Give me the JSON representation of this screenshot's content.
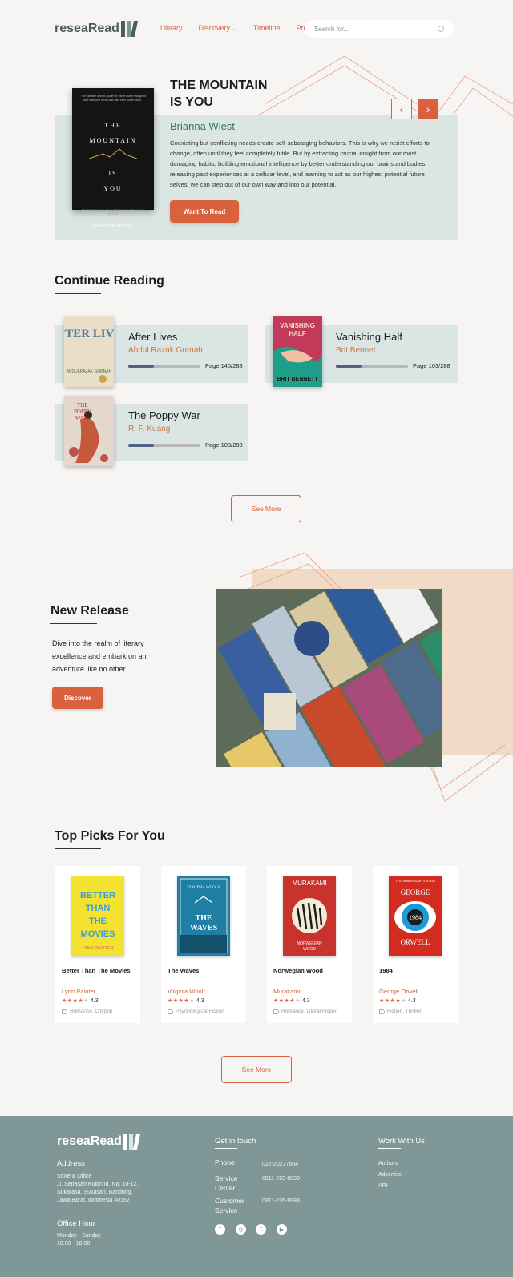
{
  "header": {
    "logo_text": "reseaRead",
    "nav": [
      "Library",
      "Discovery",
      "Timeline",
      "Profile"
    ],
    "search_placeholder": "Search for..."
  },
  "hero": {
    "title": "THE MOUNTAIN IS YOU",
    "author": "Brianna Wiest",
    "description": "Coexisting but conflicting needs create self-sabotaging behaviors. This is why we resist efforts to change, often until they feel completely futile. But by extracting crucial insight from our most damaging habits, building emotional intelligence by better understanding our brains and bodies, releasing past experiences at a cellular level, and learning to act as our highest potential future selves, we can step out of our own way and into our potential.",
    "button": "Want To Read",
    "cover": {
      "blurb": "\"The ultimate world's guide for those brave enough to face their true worth and take their power back.\"",
      "title_lines": [
        "THE",
        "MOUNTAIN",
        "IS",
        "YOU"
      ],
      "subtitle": "TRANSFORMING SELF-SABOTAGE INTO SELF-MASTERY",
      "author": "BRIANNA WIEST"
    }
  },
  "continue_reading": {
    "title": "Continue Reading",
    "books": [
      {
        "title": "After Lives",
        "author": "Abdul Razak Gurnah",
        "page": "Page 140/288",
        "progress": 0.35,
        "cover_text": "AFTER LIVES",
        "cover_author": "ABDULRAZAK GURNAH"
      },
      {
        "title": "Vanishing Half",
        "author": "Brit Bennet",
        "page": "Page 103/288",
        "progress": 0.36,
        "cover_text": "VANISHING HALF",
        "cover_author": "BRIT BENNETT"
      },
      {
        "title": "The Poppy War",
        "author": "R. F. Kuang",
        "page": "Page 103/288",
        "progress": 0.36,
        "cover_text": "THE POPPY WAR"
      }
    ],
    "see_more": "See More"
  },
  "new_release": {
    "title": "New Release",
    "description": "Dive into the realm of literary excellence and embark on an adventure like no other",
    "button": "Discover"
  },
  "top_picks": {
    "title": "Top Picks For You",
    "books": [
      {
        "title": "Better Than The Movies",
        "author": "Lynn Painter",
        "rating": "4.3",
        "tags": "Romance, Citypop"
      },
      {
        "title": "The Waves",
        "author": "Virginia Woolf",
        "rating": "4.3",
        "tags": "Psychological Fiction"
      },
      {
        "title": "Norwegian Wood",
        "author": "Murakami",
        "rating": "4.3",
        "tags": "Romance, Literal Fiction"
      },
      {
        "title": "1984",
        "author": "George Orwell",
        "rating": "4.3",
        "tags": "Fiction, Thriller"
      }
    ],
    "covers": {
      "b1_title": "BETTER THAN THE MOVIES",
      "b1_author": "LYNN PAINTER",
      "b2_author": "VIRGINIA WOOLF",
      "b2_title": "THE WAVES",
      "b3_author": "MURAKAMI",
      "b3_title": "NORWEGIAN WOOD",
      "b4_banner": "75TH ANNIVERSARY EDITION",
      "b4_top": "GEORGE",
      "b4_mid": "1984",
      "b4_bottom": "ORWELL"
    },
    "see_more": "See More"
  },
  "footer": {
    "logo_text": "reseaRead",
    "address_heading": "Address",
    "address_sub": "Store & Office",
    "address_lines": [
      "Jl. Setrasari Kulon III, No. 10-12,",
      "Sukarasa, Sukasari, Bandung,",
      "Jawa Barat, Indonesia 40152"
    ],
    "office_heading": "Office Hour",
    "office_lines": [
      "Monday - Sunday",
      "10.00 - 18.00"
    ],
    "contact_heading": "Get in touch",
    "contacts": [
      {
        "label": "Phone",
        "value": "022-20277564"
      },
      {
        "label": "Service Center",
        "value": "0811-233-8899"
      },
      {
        "label": "Customer Service",
        "value": "0811-235-9988"
      }
    ],
    "work_heading": "Work With Us",
    "work_links": [
      "Authors",
      "Advertise",
      "API"
    ],
    "socials": [
      "facebook-icon",
      "instagram-icon",
      "twitter-icon",
      "youtube-icon"
    ]
  },
  "colors": {
    "accent": "#d9613e",
    "panel": "#dae5e4",
    "footer": "#7f9897",
    "progress": "#4e6288"
  }
}
